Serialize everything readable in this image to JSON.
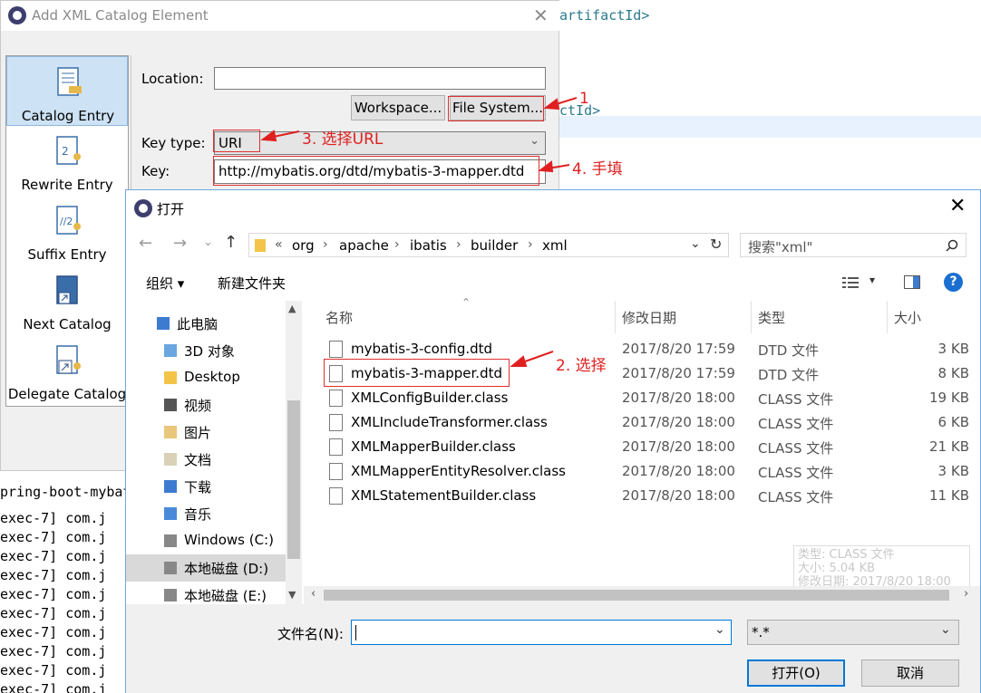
{
  "background": {
    "code_lines": [
      "/artifactId>",
      "ctId>"
    ],
    "console_lines": [
      "pring-boot-mybati",
      "exec-7] com.j",
      "exec-7] com.j",
      "exec-7] com.j",
      "exec-7] com.j",
      "exec-7] com.j",
      "exec-7] com.j",
      "exec-7] com.j",
      "exec-7] com.j",
      "exec-7] com.j",
      "exec-7] com.j"
    ]
  },
  "xml_dialog": {
    "title": "Add XML Catalog Element",
    "close": "✕",
    "sidebar": [
      {
        "label": "Catalog Entry",
        "selected": true,
        "icon": "catalog-entry-icon"
      },
      {
        "label": "Rewrite Entry",
        "selected": false,
        "icon": "rewrite-entry-icon"
      },
      {
        "label": "Suffix Entry",
        "selected": false,
        "icon": "suffix-entry-icon"
      },
      {
        "label": "Next Catalog",
        "selected": false,
        "icon": "next-catalog-icon"
      },
      {
        "label": "Delegate Catalog",
        "selected": false,
        "icon": "delegate-catalog-icon"
      }
    ],
    "location_label": "Location:",
    "location_value": "",
    "workspace_button": "Workspace...",
    "filesystem_button": "File System...",
    "key_type_label": "Key type:",
    "key_type_value": "URI",
    "key_label": "Key:",
    "key_value": "http://mybatis.org/dtd/mybatis-3-mapper.dtd"
  },
  "annotations": {
    "a1": "1",
    "a2": "2. 选择",
    "a3": "3. 选择URL",
    "a4": "4. 手填",
    "color": "#e02020"
  },
  "open_dialog": {
    "title": "打开",
    "close": "✕",
    "breadcrumb_prefix": "«",
    "breadcrumb": [
      "org",
      "apache",
      "ibatis",
      "builder",
      "xml"
    ],
    "search_placeholder": "搜索\"xml\"",
    "organize": "组织 ▾",
    "new_folder": "新建文件夹",
    "help": "?",
    "nav_items": [
      {
        "label": "此电脑",
        "icon": "pc-icon"
      },
      {
        "label": "3D 对象",
        "icon": "3d-objects-icon"
      },
      {
        "label": "Desktop",
        "icon": "desktop-folder-icon"
      },
      {
        "label": "视频",
        "icon": "videos-icon"
      },
      {
        "label": "图片",
        "icon": "pictures-icon"
      },
      {
        "label": "文档",
        "icon": "documents-icon"
      },
      {
        "label": "下载",
        "icon": "downloads-icon"
      },
      {
        "label": "音乐",
        "icon": "music-icon"
      },
      {
        "label": "Windows (C:)",
        "icon": "drive-icon"
      },
      {
        "label": "本地磁盘 (D:)",
        "icon": "drive-icon",
        "selected": true
      },
      {
        "label": "本地磁盘 (E:)",
        "icon": "drive-icon"
      }
    ],
    "columns": [
      "名称",
      "修改日期",
      "类型",
      "大小"
    ],
    "files": [
      {
        "name": "mybatis-3-config.dtd",
        "date": "2017/8/20 17:59",
        "type": "DTD 文件",
        "size": "3 KB"
      },
      {
        "name": "mybatis-3-mapper.dtd",
        "date": "2017/8/20 17:59",
        "type": "DTD 文件",
        "size": "8 KB"
      },
      {
        "name": "XMLConfigBuilder.class",
        "date": "2017/8/20 18:00",
        "type": "CLASS 文件",
        "size": "19 KB"
      },
      {
        "name": "XMLIncludeTransformer.class",
        "date": "2017/8/20 18:00",
        "type": "CLASS 文件",
        "size": "6 KB"
      },
      {
        "name": "XMLMapperBuilder.class",
        "date": "2017/8/20 18:00",
        "type": "CLASS 文件",
        "size": "21 KB"
      },
      {
        "name": "XMLMapperEntityResolver.class",
        "date": "2017/8/20 18:00",
        "type": "CLASS 文件",
        "size": "3 KB"
      },
      {
        "name": "XMLStatementBuilder.class",
        "date": "2017/8/20 18:00",
        "type": "CLASS 文件",
        "size": "11 KB"
      }
    ],
    "tooltip": [
      "类型: CLASS 文件",
      "大小: 5.04 KB",
      "修改日期: 2017/8/20 18:00"
    ],
    "filename_label": "文件名(N):",
    "filename_value": "",
    "filter_value": "*.*",
    "open_button": "打开(O)",
    "cancel_button": "取消"
  }
}
